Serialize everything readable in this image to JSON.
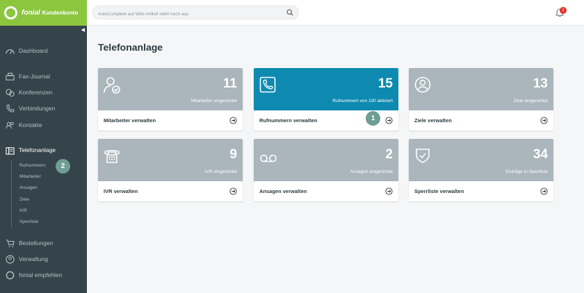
{
  "brand": {
    "name": "fonial",
    "sub": "Kundenkonto"
  },
  "search": {
    "placeholder": "AutoComplete auf Wiki-Artikel steht noch aus"
  },
  "notifications": {
    "count": "1"
  },
  "nav": {
    "dashboard": "Dashboard",
    "fax": "Fax-Journal",
    "conferences": "Konferenzen",
    "connections": "Verbindungen",
    "contacts": "Kontakte",
    "phone_system": "Telefonanlage",
    "orders": "Bestellungen",
    "admin": "Verwaltung",
    "recommend": "fonial empfehlen"
  },
  "subnav": [
    "Rufnummern",
    "Mitarbeiter",
    "Ansagen",
    "Ziele",
    "IVR",
    "Sperrliste"
  ],
  "markers": {
    "one": "1",
    "two": "2"
  },
  "page": {
    "title": "Telefonanlage"
  },
  "cards": [
    {
      "count": "11",
      "desc": "Mitarbeiter eingerichtet",
      "link": "Mitarbeiter verwalten",
      "icon": "user-check-icon"
    },
    {
      "count": "15",
      "desc": "Rufnummern von 100 aktiviert",
      "link": "Rufnummern verwalten",
      "icon": "phone-card-icon"
    },
    {
      "count": "13",
      "desc": "Ziele eingerichtet",
      "link": "Ziele verwalten",
      "icon": "user-circle-icon"
    },
    {
      "count": "9",
      "desc": "IVR eingerichtet",
      "link": "IVR verwalten",
      "icon": "desk-phone-icon"
    },
    {
      "count": "2",
      "desc": "Ansagen eingerichtet",
      "link": "Ansagen verwalten",
      "icon": "voicemail-icon"
    },
    {
      "count": "34",
      "desc": "Einträge in Sperrliste",
      "link": "Sperrliste verwalten",
      "icon": "shield-icon"
    }
  ],
  "colors": {
    "brand_green": "#8cc63f",
    "sidebar": "#34444a",
    "card_gray": "#aab5bc",
    "card_blue": "#0e8ab0",
    "marker": "#6e9e94"
  }
}
